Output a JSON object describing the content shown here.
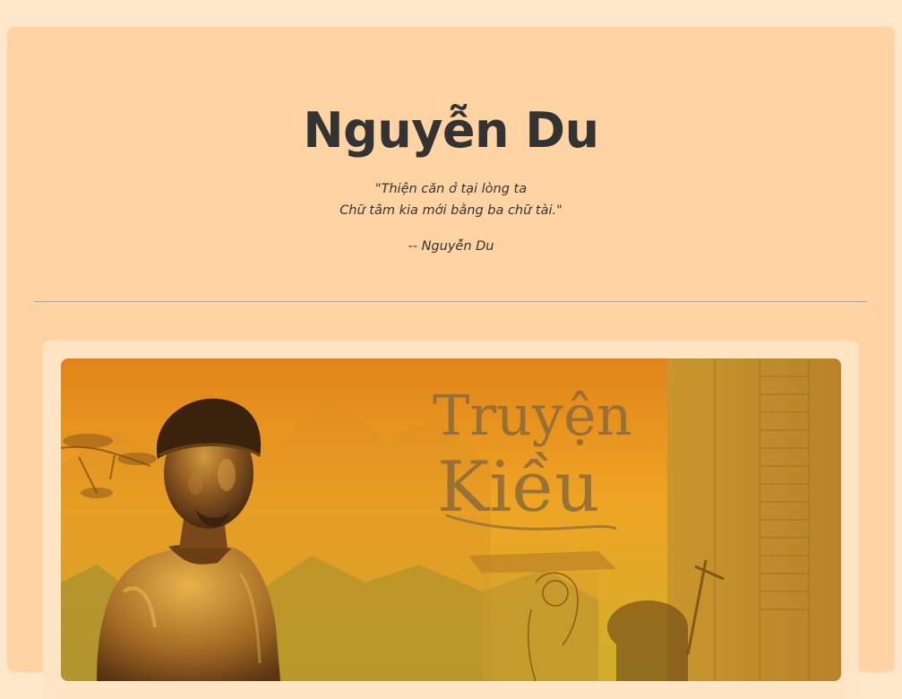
{
  "page": {
    "title": "Nguyễn Du",
    "quote_lines": [
      "\"Thiện căn ở tại lòng ta",
      "Chữ tâm kia mới bằng ba chữ tài.\""
    ],
    "attribution": "-- Nguyễn Du"
  },
  "poster": {
    "subject": "statue-of-nguyen-du",
    "caption_line1": "Truyện",
    "caption_line2": "Kiều"
  },
  "colors": {
    "page_background": "#ffe8c9",
    "card_background": "#ffd4a2",
    "frame_background": "#ffe5c4",
    "text": "#333333",
    "divider": "#a7a7a7"
  }
}
